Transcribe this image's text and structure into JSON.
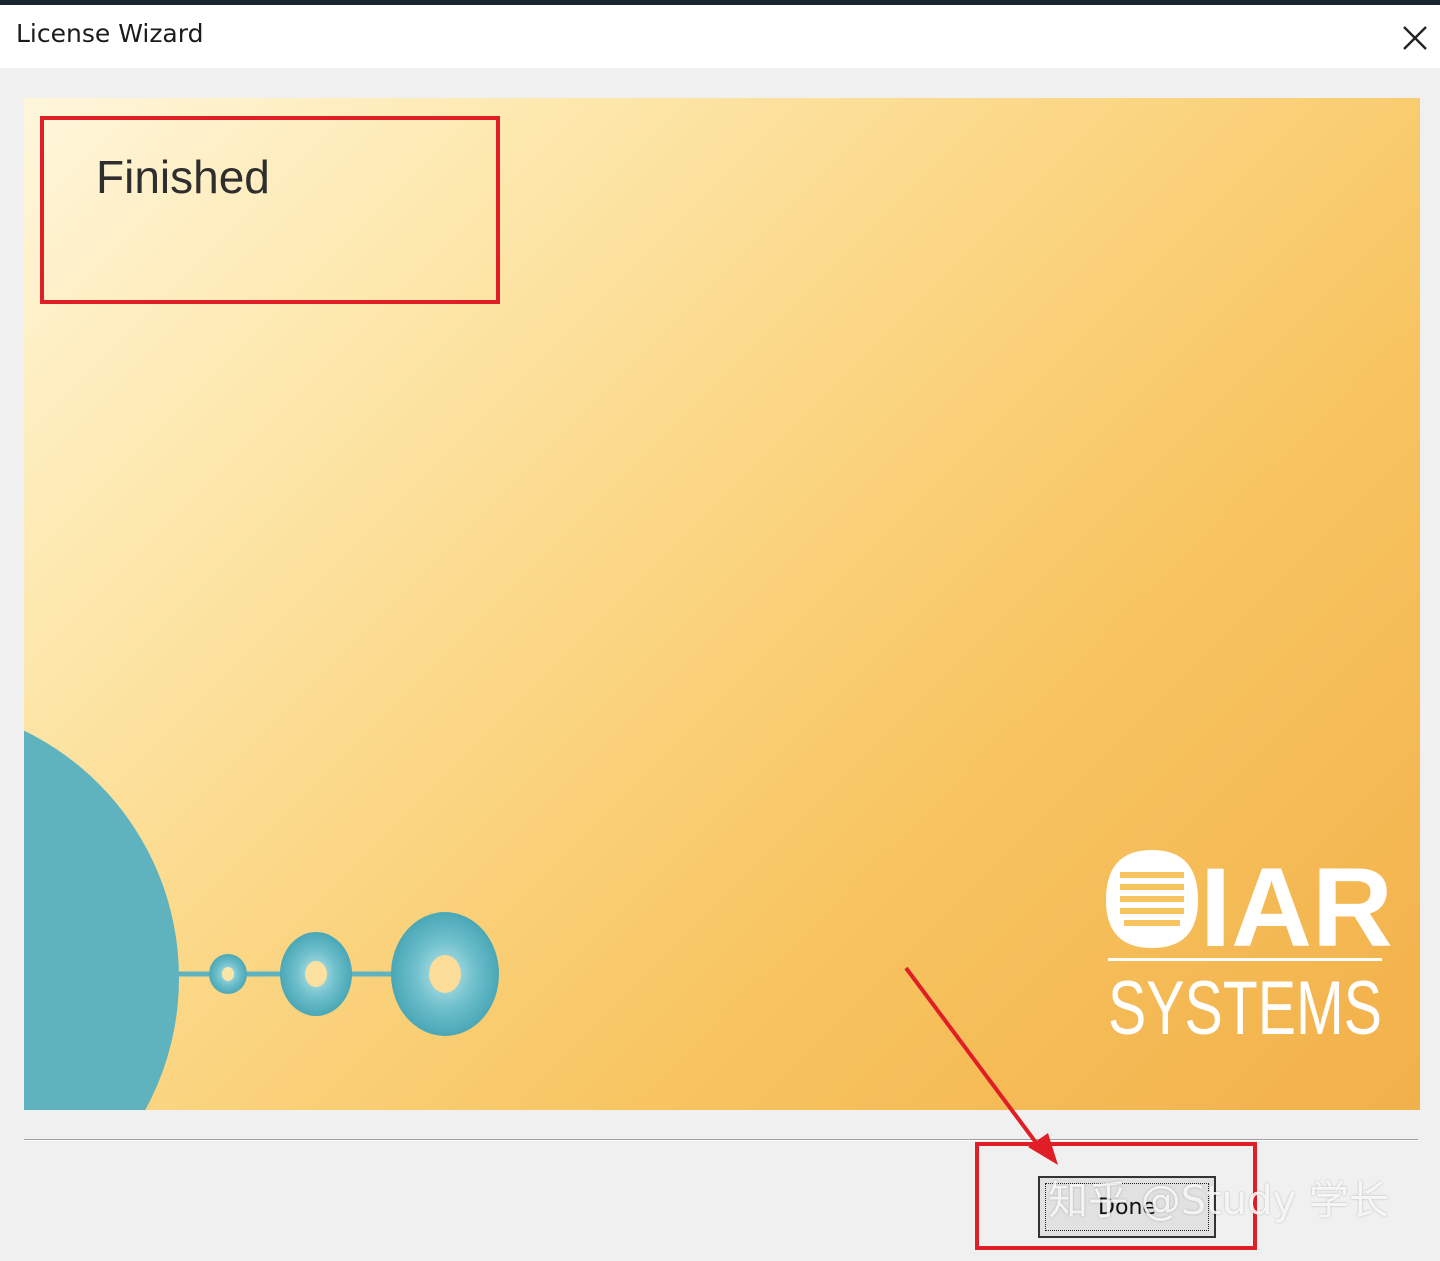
{
  "window": {
    "title": "License Wizard"
  },
  "banner": {
    "heading": "Finished",
    "logo_text_primary": "IAR",
    "logo_text_secondary": "SYSTEMS"
  },
  "footer": {
    "done_label": "Done"
  },
  "watermark": {
    "text": "知乎 @Study 学长"
  },
  "colors": {
    "annotation_red": "#e01e25",
    "teal": "#5fb3bf",
    "banner_orange": "#f2b04a"
  },
  "icons": {
    "close": "close-icon",
    "logo_mark": "iar-logo-icon",
    "arrow": "annotation-arrow-icon"
  }
}
